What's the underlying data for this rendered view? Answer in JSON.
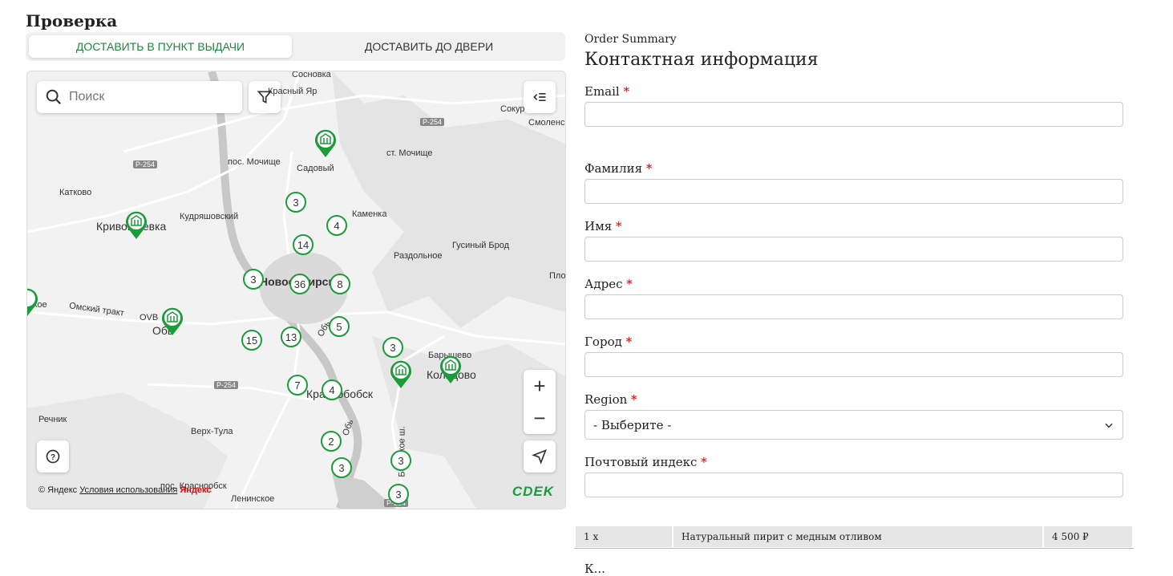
{
  "page_title": "Проверка",
  "tabs": [
    {
      "label": "ДОСТАВИТЬ В ПУНКТ ВЫДАЧИ",
      "active": true
    },
    {
      "label": "ДОСТАВИТЬ ДО ДВЕРИ",
      "active": false
    }
  ],
  "map": {
    "search_placeholder": "Поиск",
    "places": [
      "Сосновка",
      "Красный Яр",
      "Сокур",
      "Смоленс",
      "пос. Мочище",
      "Садовый",
      "ст. Мочище",
      "Катково",
      "Кривошеевка",
      "Кудряшовский",
      "Каменка",
      "Гусиный Брод",
      "Раздольное",
      "Пло",
      "Новосибирск",
      "ское",
      "Омский тракт",
      "OVB",
      "Обь",
      "Обь",
      "Барышево",
      "Кольцово",
      "Краснобобск",
      "Обь",
      "Речник",
      "Верх-Тула",
      "пос. Краснообск",
      "Ленинское",
      "Бердское ш."
    ],
    "roads": [
      "Р-254",
      "Р-254",
      "Р-254",
      "Р-254"
    ],
    "clusters": [
      "3",
      "4",
      "14",
      "3",
      "36",
      "8",
      "5",
      "15",
      "13",
      "3",
      "7",
      "4",
      "2",
      "3",
      "3",
      "3"
    ],
    "copyright": "© Яндекс",
    "terms_link": "Условия использования",
    "yandex_logo": "Яндекс",
    "brand": "CDEK",
    "accent_color": "#1c9b3a"
  },
  "summary": {
    "header": "Order Summary",
    "title": "Контактная информация"
  },
  "form": {
    "required_mark": "*",
    "email_label": "Email",
    "lastname_label": "Фамилия",
    "firstname_label": "Имя",
    "address_label": "Адрес",
    "city_label": "Город",
    "region_label": "Region",
    "region_selected": "- Выберите -",
    "zip_label": "Почтовый индекс"
  },
  "order": {
    "qty": "1 x",
    "product": "Натуральный пирит с медным отливом",
    "price": "4 500 ₽"
  },
  "bottom_cut_text": "К..."
}
